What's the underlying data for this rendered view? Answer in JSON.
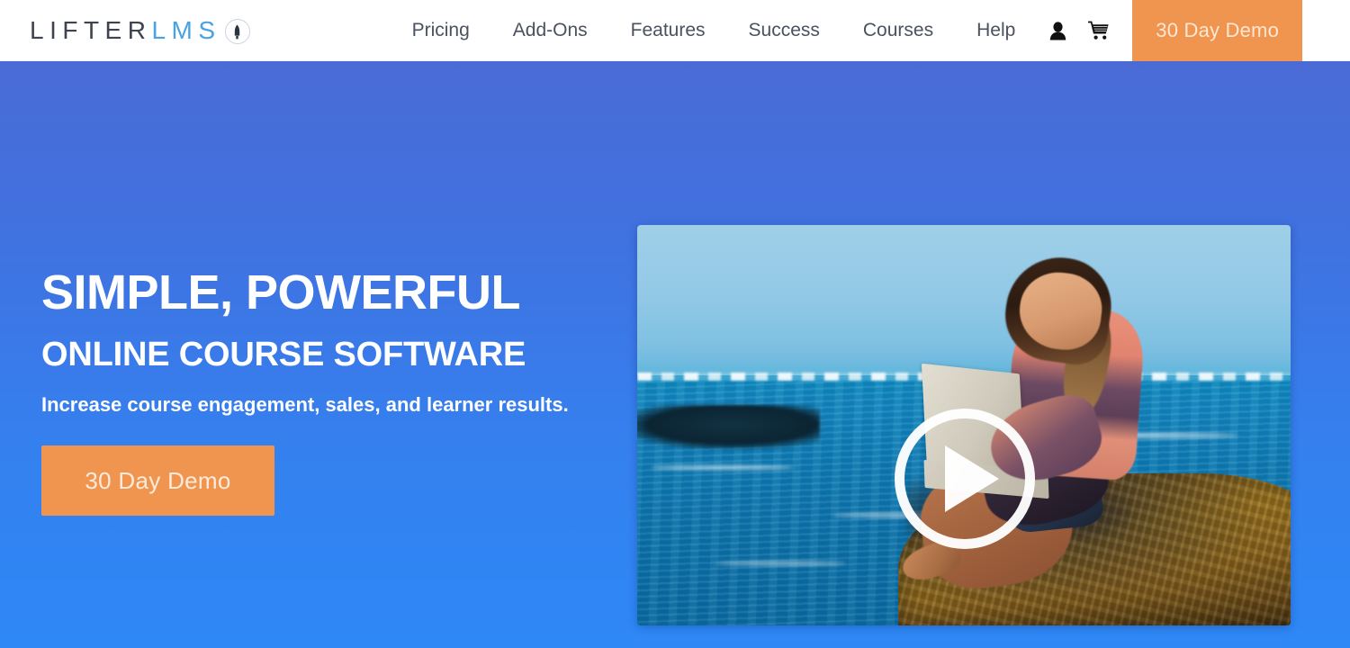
{
  "header": {
    "logo": {
      "primary": "LIFTER",
      "secondary": "LMS",
      "badge_icon": "rocket-icon",
      "primary_color": "#3d4450",
      "secondary_color": "#47a3e3"
    },
    "nav_items": [
      {
        "label": "Pricing"
      },
      {
        "label": "Add-Ons"
      },
      {
        "label": "Features"
      },
      {
        "label": "Success"
      },
      {
        "label": "Courses"
      },
      {
        "label": "Help"
      }
    ],
    "account_icon": "user-icon",
    "cart_icon": "shopping-cart-icon",
    "cta_label": "30 Day Demo",
    "cta_bg_color": "#f0954f",
    "cta_text_color": "#fde7d3"
  },
  "hero": {
    "headline_line1": "SIMPLE, POWERFUL",
    "headline_line2": "ONLINE COURSE SOFTWARE",
    "tagline": "Increase course engagement, sales, and learner results.",
    "cta_label": "30 Day Demo",
    "background_gradient_top": "#4a6bd6",
    "background_gradient_bottom": "#2e88f6",
    "text_color": "#ffffff"
  },
  "video": {
    "play_icon": "play-icon",
    "scene_description": "Woman sitting on a rock by the ocean using a laptop"
  }
}
